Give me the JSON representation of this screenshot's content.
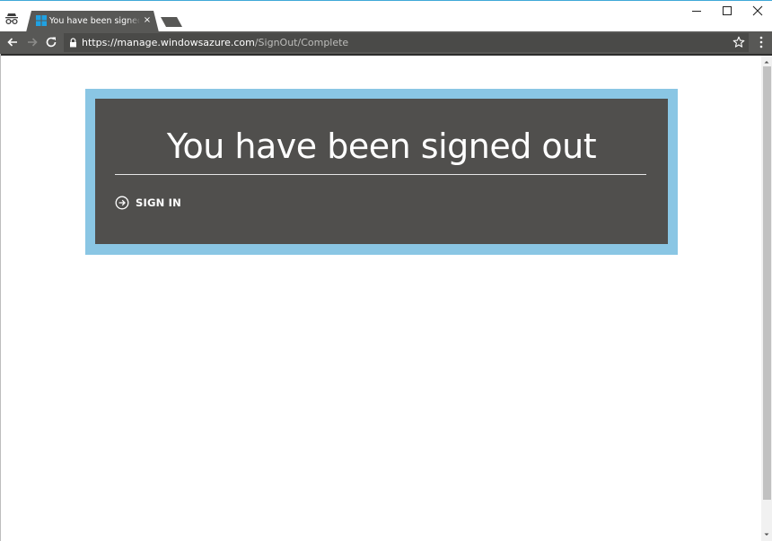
{
  "browser": {
    "tab": {
      "title": "You have been signed out",
      "close_glyph": "×",
      "favicon": "windows-logo-icon"
    },
    "address_bar": {
      "url_host": "https://manage.windowsazure.com",
      "url_path": "/SignOut/Complete"
    },
    "icons": {
      "incognito": "incognito-icon",
      "back": "back-arrow-icon",
      "forward": "forward-arrow-icon",
      "reload": "reload-icon",
      "lock": "lock-icon",
      "bookmark": "star-icon",
      "menu": "kebab-menu-icon"
    }
  },
  "page": {
    "heading": "You have been signed out",
    "signin_label": "SIGN IN",
    "signin_icon": "arrow-circle-right-icon"
  },
  "colors": {
    "card_frame": "#8ac6e4",
    "card_background": "#504f4d",
    "browser_chrome": "#585856",
    "accent_top_border": "#3fa8d8"
  }
}
